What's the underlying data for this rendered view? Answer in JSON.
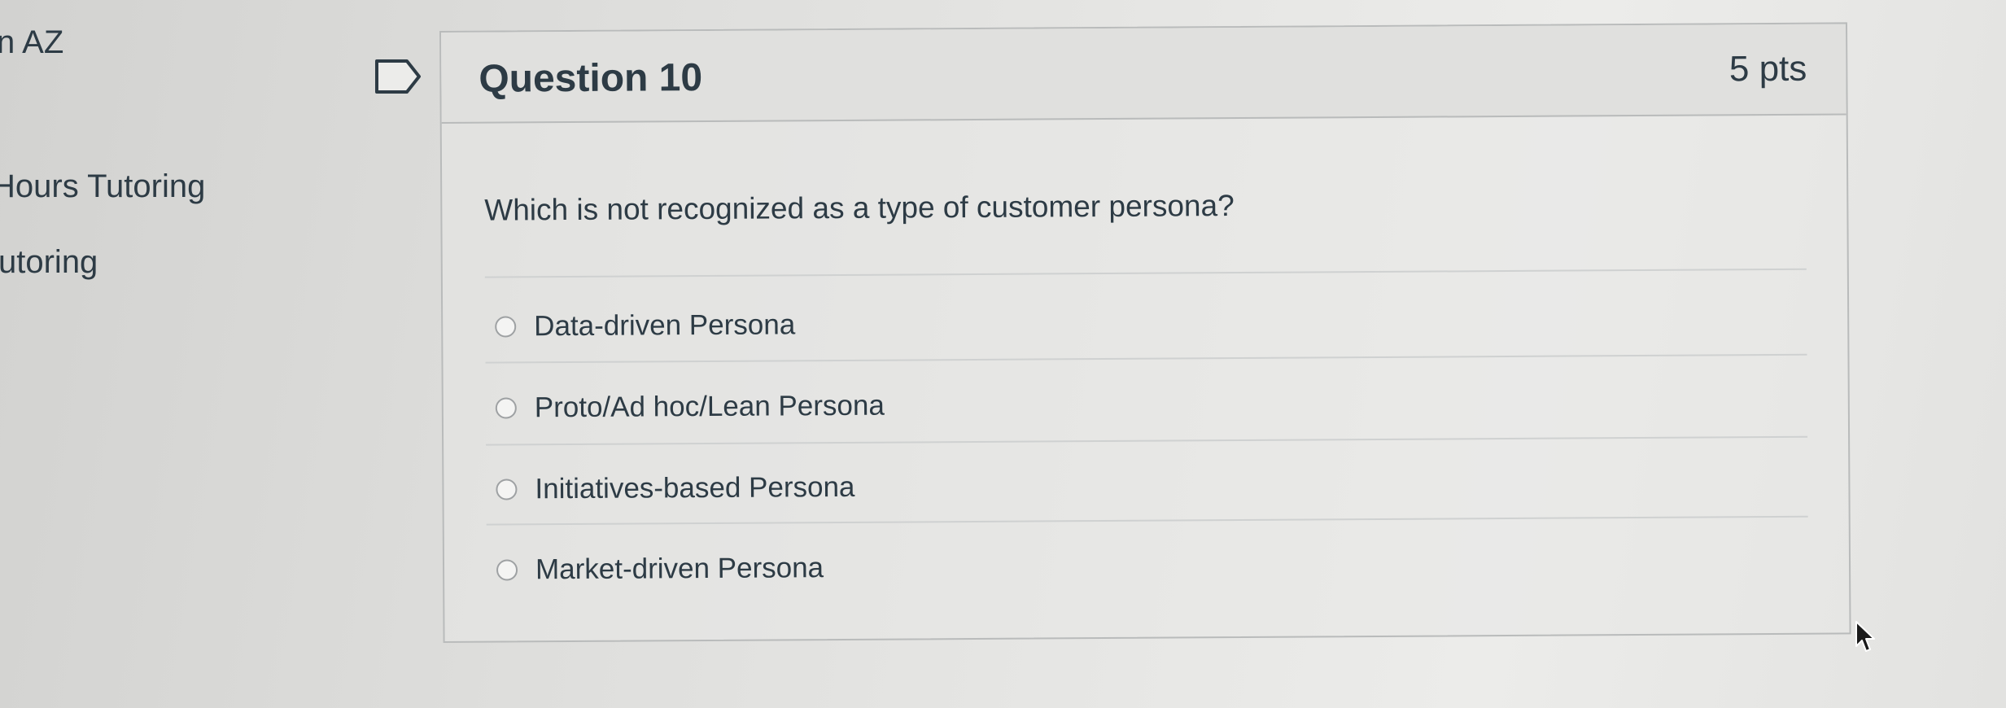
{
  "sidebar": {
    "items": [
      {
        "label": "n AZ"
      },
      {
        "label": "Hours Tutoring"
      },
      {
        "label": "utoring"
      }
    ]
  },
  "question": {
    "title": "Question 10",
    "points": "5 pts",
    "text": "Which is not recognized as a type of customer persona?",
    "answers": [
      {
        "label": "Data-driven Persona",
        "selected": false
      },
      {
        "label": "Proto/Ad hoc/Lean Persona",
        "selected": false
      },
      {
        "label": "Initiatives-based Persona",
        "selected": false
      },
      {
        "label": "Market-driven Persona",
        "selected": false
      }
    ]
  },
  "icons": {
    "bookmark": "bookmark-flag-icon",
    "cursor": "mouse-pointer-icon"
  },
  "colors": {
    "text": "#2d3b45",
    "border": "#b9bbbb",
    "header_bg": "#e0e0de"
  }
}
